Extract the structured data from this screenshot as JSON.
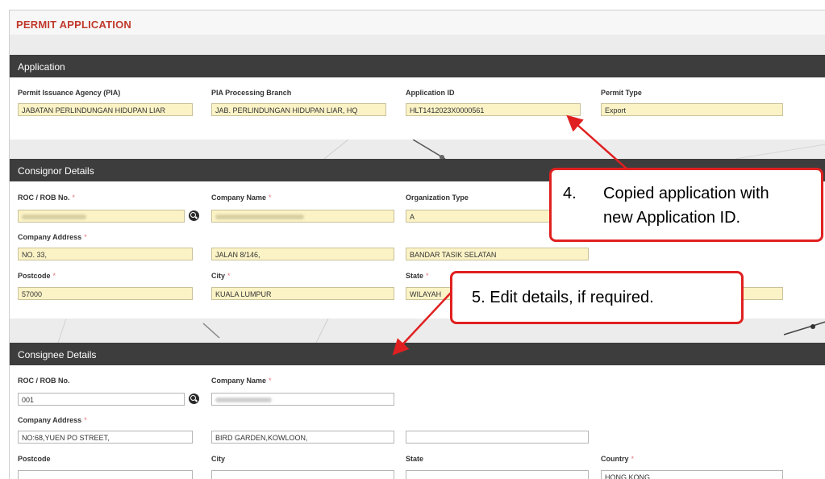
{
  "page": {
    "title": "PERMIT APPLICATION"
  },
  "application": {
    "header": "Application",
    "pia_label": "Permit Issuance Agency (PIA)",
    "pia_value": "JABATAN PERLINDUNGAN HIDUPAN LIAR",
    "branch_label": "PIA Processing Branch",
    "branch_value": "JAB. PERLINDUNGAN HIDUPAN LIAR, HQ",
    "app_id_label": "Application ID",
    "app_id_value": "HLT1412023X0000561",
    "permit_type_label": "Permit Type",
    "permit_type_value": "Export"
  },
  "consignor": {
    "header": "Consignor Details",
    "roc_label": "ROC / ROB No.",
    "company_name_label": "Company Name",
    "org_type_label": "Organization Type",
    "org_type_value": "A",
    "address_label": "Company Address",
    "address1": "NO. 33,",
    "address2": "JALAN 8/146,",
    "address3": "BANDAR TASIK SELATAN",
    "postcode_label": "Postcode",
    "postcode_value": "57000",
    "city_label": "City",
    "city_value": "KUALA LUMPUR",
    "state_label": "State",
    "state_value": "WILAYAH"
  },
  "consignee": {
    "header": "Consignee Details",
    "roc_label": "ROC / ROB No.",
    "roc_value": "001",
    "company_name_label": "Company Name",
    "address_label": "Company Address",
    "address1": "NO:68,YUEN PO STREET,",
    "address2": "BIRD GARDEN,KOWLOON,",
    "address3": "",
    "postcode_label": "Postcode",
    "city_label": "City",
    "state_label": "State",
    "country_label": "Country",
    "country_value": "HONG KONG"
  },
  "required_mark": "*",
  "callouts": {
    "c4_number": "4.",
    "c4_line1": "Copied application with",
    "c4_line2": "new Application ID.",
    "c5_text": "5.  Edit details, if required."
  },
  "colors": {
    "header_bg": "#3d3d3d",
    "title": "#c0392b",
    "field_bg": "#fbf3c6",
    "callout_border": "#e02020"
  },
  "icons": {
    "search": "search-icon"
  }
}
